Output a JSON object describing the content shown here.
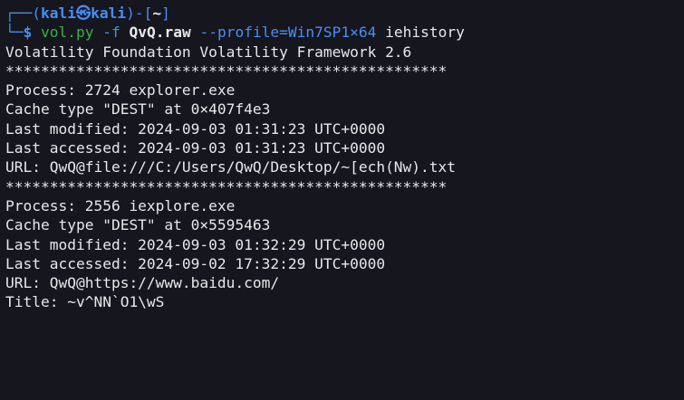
{
  "prompt": {
    "box_top": "┌──(",
    "user": "kali",
    "at_icon": "㉿",
    "host": "kali",
    "close_paren": ")-[",
    "cwd": "~",
    "close_bracket": "]",
    "box_bottom": "└─",
    "dollar": "$"
  },
  "command": {
    "program": "vol.py",
    "flag_f": "-f",
    "file": "QvQ.raw",
    "profile_opt": "--profile=Win7SP1×64",
    "plugin": "iehistory"
  },
  "output_lines": [
    "Volatility Foundation Volatility Framework 2.6",
    "**************************************************",
    "Process: 2724 explorer.exe",
    "Cache type \"DEST\" at 0×407f4e3",
    "Last modified: 2024-09-03 01:31:23 UTC+0000",
    "Last accessed: 2024-09-03 01:31:23 UTC+0000",
    "URL: QwQ@file:///C:/Users/QwQ/Desktop/~[ech(Nw).txt",
    "**************************************************",
    "Process: 2556 iexplore.exe",
    "Cache type \"DEST\" at 0×5595463",
    "Last modified: 2024-09-03 01:32:29 UTC+0000",
    "Last accessed: 2024-09-02 17:32:29 UTC+0000",
    "URL: QwQ@https://www.baidu.com/",
    "Title: ~v^NN`O1\\wS"
  ],
  "colors": {
    "background": "#15161e",
    "prompt_blue": "#4a8df5",
    "command_green": "#36b24a",
    "text": "#e8e8ea"
  }
}
